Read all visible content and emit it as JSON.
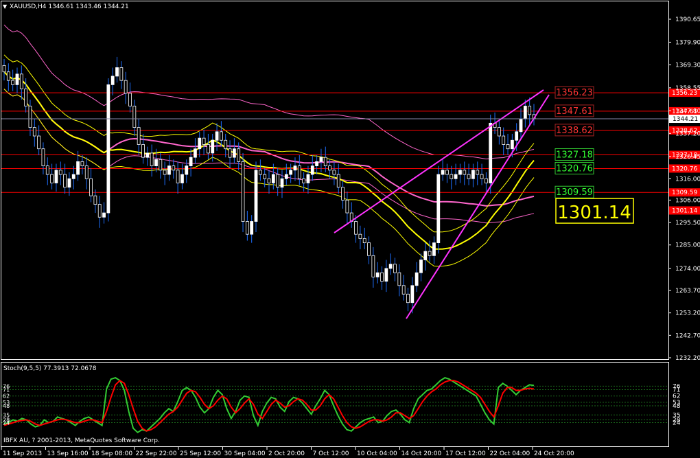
{
  "main_title": "XAUUSD,H4  1346.61 1343.46 1344.21",
  "main_title_parts": {
    "symbol": "XAUUSD,H4",
    "open": "1346.61",
    "high": "1346.61",
    "low": "1343.46",
    "close": "1344.21"
  },
  "stoch_title": "Stoch(9,5,5) 77.3913 72.0678",
  "copyright": "IBFX AU, ? 2001-2013, MetaQuotes Software Corp.",
  "current_price_label": "1344.21",
  "big_label": "1301.14",
  "colors": {
    "background": "#000000",
    "grid_frame": "#ffffff",
    "candle": "#ffffff",
    "wick": "#1e6fff",
    "hline": "#ff0000",
    "channel": "#ff33ff",
    "ma_yellow": "#ffff00",
    "ma_pink": "#ff66cc",
    "stoch_main": "#33cc33",
    "stoch_signal": "#ff0000",
    "label_red_text": "#ff3333",
    "label_green_text": "#33ff33",
    "big_label_border": "#ffff00",
    "big_label_text": "#ffff00"
  },
  "chart_data": {
    "type": "candlestick",
    "price_axis_ticks": [
      "1390.65",
      "1379.90",
      "1369.30",
      "1358.55",
      "1347.80",
      "1337.20",
      "1326.45",
      "1316.00",
      "1306.00",
      "1295.50",
      "1285.00",
      "1274.00",
      "1263.70",
      "1253.20",
      "1242.70",
      "1232.20"
    ],
    "stoch_axis_ticks": [
      "76",
      "71",
      "62",
      "53",
      "48",
      "35",
      "28",
      "24"
    ],
    "time_axis_labels": [
      "11 Sep 2013",
      "13 Sep 16:00",
      "18 Sep 08:00",
      "22 Sep 22:00",
      "25 Sep 12:00",
      "30 Sep 04:00",
      "2 Oct 20:00",
      "7 Oct 12:00",
      "10 Oct 04:00",
      "14 Oct 20:00",
      "17 Oct 12:00",
      "22 Oct 04:00",
      "24 Oct 20:00"
    ],
    "horizontal_levels": [
      {
        "price": 1356.23,
        "label": "1356.23",
        "style": "red"
      },
      {
        "price": 1347.61,
        "label": "1347.61",
        "style": "red"
      },
      {
        "price": 1338.62,
        "label": "1338.62",
        "style": "red"
      },
      {
        "price": 1327.18,
        "label": "1327.18",
        "style": "green"
      },
      {
        "price": 1320.76,
        "label": "1320.76",
        "style": "green"
      },
      {
        "price": 1309.59,
        "label": "1309.59",
        "style": "green"
      }
    ],
    "axis_level_tags": [
      "1356.23",
      "1347.61",
      "1338.62",
      "1327.18",
      "1320.76",
      "1309.59",
      "1301.14"
    ],
    "closes": [
      1366,
      1362,
      1360,
      1365,
      1358,
      1350,
      1340,
      1336,
      1330,
      1322,
      1318,
      1314,
      1320,
      1318,
      1312,
      1316,
      1318,
      1324,
      1322,
      1316,
      1308,
      1304,
      1298,
      1300,
      1360,
      1364,
      1368,
      1362,
      1356,
      1350,
      1340,
      1332,
      1326,
      1328,
      1322,
      1325,
      1320,
      1318,
      1322,
      1320,
      1314,
      1318,
      1322,
      1326,
      1330,
      1335,
      1332,
      1328,
      1334,
      1338,
      1334,
      1330,
      1326,
      1330,
      1324,
      1296,
      1290,
      1296,
      1320,
      1318,
      1316,
      1314,
      1318,
      1312,
      1316,
      1318,
      1320,
      1322,
      1316,
      1314,
      1318,
      1322,
      1324,
      1326,
      1322,
      1320,
      1318,
      1312,
      1306,
      1300,
      1296,
      1290,
      1288,
      1286,
      1280,
      1270,
      1272,
      1268,
      1274,
      1276,
      1272,
      1266,
      1262,
      1258,
      1266,
      1272,
      1278,
      1282,
      1280,
      1286,
      1318,
      1320,
      1318,
      1316,
      1318,
      1320,
      1318,
      1316,
      1320,
      1318,
      1316,
      1314,
      1342,
      1340,
      1336,
      1332,
      1330,
      1334,
      1338,
      1344,
      1350,
      1346,
      1344
    ],
    "stoch_main": [
      22,
      24,
      28,
      26,
      30,
      28,
      22,
      18,
      20,
      28,
      24,
      26,
      32,
      30,
      28,
      24,
      20,
      26,
      30,
      32,
      28,
      24,
      20,
      72,
      86,
      88,
      84,
      70,
      40,
      16,
      10,
      14,
      12,
      18,
      24,
      30,
      38,
      44,
      40,
      54,
      70,
      74,
      70,
      60,
      46,
      38,
      44,
      60,
      70,
      64,
      44,
      30,
      40,
      56,
      62,
      60,
      34,
      20,
      40,
      52,
      60,
      58,
      46,
      40,
      54,
      60,
      58,
      52,
      44,
      36,
      48,
      58,
      70,
      64,
      48,
      34,
      22,
      14,
      12,
      18,
      24,
      28,
      30,
      32,
      24,
      26,
      34,
      40,
      42,
      36,
      28,
      24,
      44,
      58,
      64,
      70,
      72,
      78,
      84,
      88,
      86,
      82,
      78,
      74,
      70,
      66,
      62,
      50,
      38,
      28,
      22,
      74,
      80,
      76,
      70,
      64,
      70,
      74,
      78,
      77
    ],
    "stoch_signal": [
      20,
      22,
      24,
      26,
      27,
      28,
      26,
      22,
      20,
      22,
      24,
      26,
      28,
      29,
      28,
      26,
      24,
      24,
      26,
      28,
      28,
      26,
      24,
      40,
      60,
      78,
      84,
      80,
      64,
      44,
      26,
      16,
      12,
      14,
      18,
      24,
      30,
      36,
      40,
      46,
      56,
      66,
      70,
      68,
      60,
      50,
      44,
      48,
      56,
      62,
      58,
      46,
      38,
      44,
      52,
      58,
      50,
      36,
      30,
      40,
      50,
      56,
      52,
      46,
      48,
      54,
      58,
      56,
      50,
      42,
      42,
      48,
      58,
      64,
      58,
      46,
      34,
      24,
      18,
      16,
      18,
      22,
      26,
      28,
      28,
      26,
      28,
      32,
      38,
      38,
      34,
      30,
      34,
      44,
      54,
      62,
      68,
      72,
      78,
      82,
      84,
      84,
      82,
      78,
      74,
      70,
      66,
      60,
      50,
      40,
      32,
      48,
      66,
      74,
      74,
      70,
      70,
      72,
      73,
      72
    ]
  }
}
